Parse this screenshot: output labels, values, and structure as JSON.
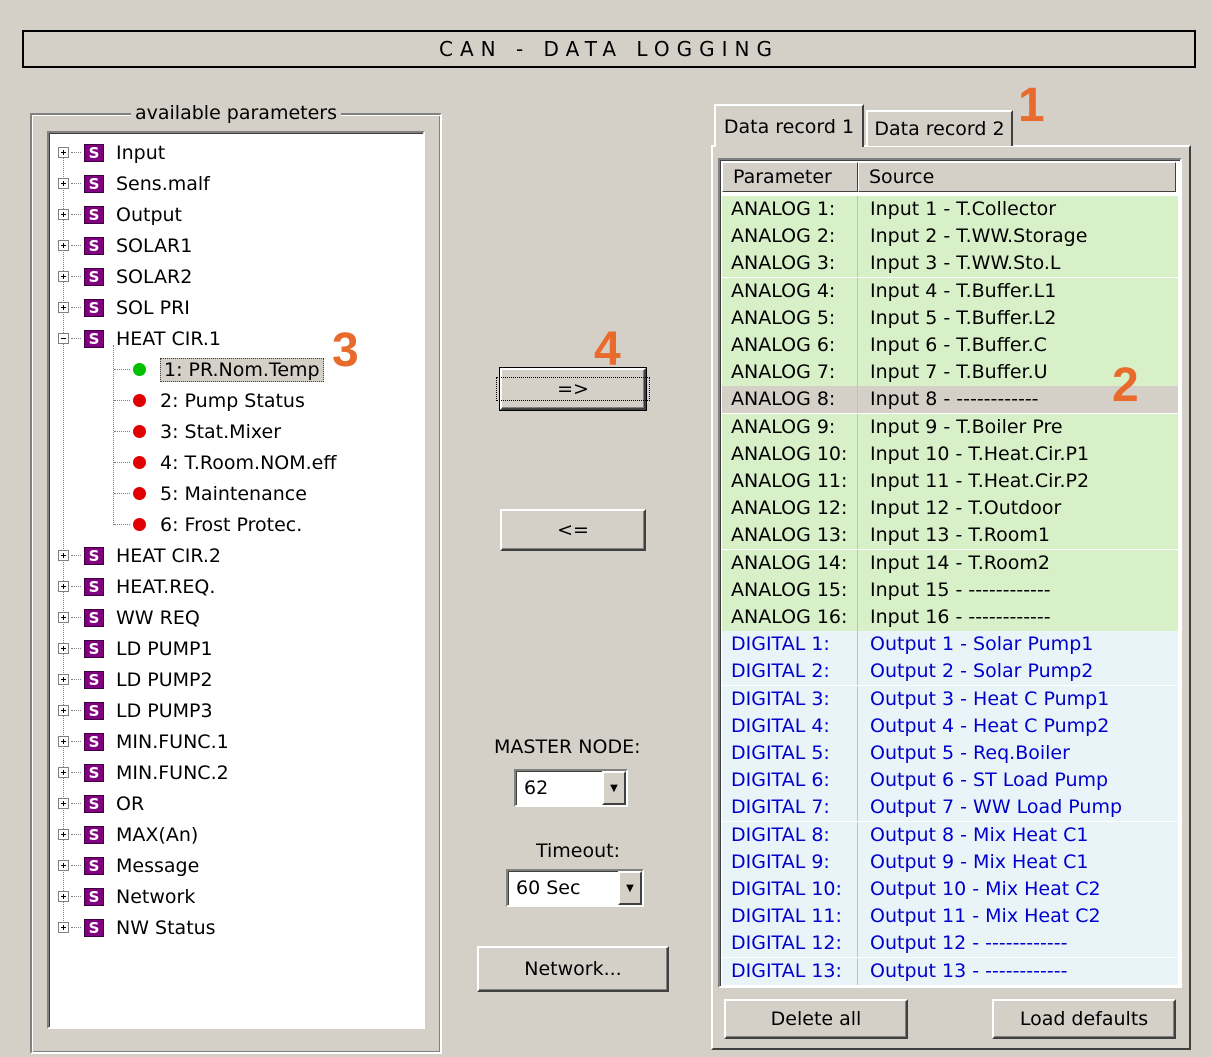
{
  "title": "CAN - DATA LOGGING",
  "available_parameters": {
    "legend": "available parameters",
    "tree": [
      {
        "label": "Input",
        "expanded": false
      },
      {
        "label": "Sens.malf",
        "expanded": false
      },
      {
        "label": "Output",
        "expanded": false
      },
      {
        "label": "SOLAR1",
        "expanded": false
      },
      {
        "label": "SOLAR2",
        "expanded": false
      },
      {
        "label": "SOL PRI",
        "expanded": false
      },
      {
        "label": "HEAT CIR.1",
        "expanded": true
      }
    ],
    "heat_cir1_children": [
      {
        "label": "1: PR.Nom.Temp",
        "status": "green",
        "selected": true
      },
      {
        "label": "2: Pump Status",
        "status": "red"
      },
      {
        "label": "3: Stat.Mixer",
        "status": "red"
      },
      {
        "label": "4: T.Room.NOM.eff",
        "status": "red"
      },
      {
        "label": "5: Maintenance",
        "status": "red"
      },
      {
        "label": "6: Frost Protec.",
        "status": "red"
      }
    ],
    "tree_after": [
      {
        "label": "HEAT CIR.2"
      },
      {
        "label": "HEAT.REQ."
      },
      {
        "label": "WW REQ"
      },
      {
        "label": "LD PUMP1"
      },
      {
        "label": "LD PUMP2"
      },
      {
        "label": "LD PUMP3"
      },
      {
        "label": "MIN.FUNC.1"
      },
      {
        "label": "MIN.FUNC.2"
      },
      {
        "label": "OR"
      },
      {
        "label": "MAX(An)"
      },
      {
        "label": "Message"
      },
      {
        "label": "Network"
      },
      {
        "label": "NW Status"
      }
    ],
    "icon_letter": "S"
  },
  "controls": {
    "add_button": "=>",
    "remove_button": "<=",
    "master_node_label": "MASTER NODE:",
    "master_node_value": "62",
    "timeout_label": "Timeout:",
    "timeout_value": "60 Sec",
    "network_button": "Network..."
  },
  "tabs": [
    {
      "label": "Data record 1",
      "active": true
    },
    {
      "label": "Data record 2",
      "active": false
    }
  ],
  "list": {
    "headers": [
      "Parameter",
      "Source"
    ],
    "rows": [
      {
        "param": "ANALOG 1:",
        "source": "Input 1 - T.Collector",
        "kind": "analog"
      },
      {
        "param": "ANALOG 2:",
        "source": "Input 2 - T.WW.Storage",
        "kind": "analog"
      },
      {
        "param": "ANALOG 3:",
        "source": "Input 3 - T.WW.Sto.L",
        "kind": "analog"
      },
      {
        "param": "ANALOG 4:",
        "source": "Input 4 - T.Buffer.L1",
        "kind": "analog"
      },
      {
        "param": "ANALOG 5:",
        "source": "Input 5 - T.Buffer.L2",
        "kind": "analog"
      },
      {
        "param": "ANALOG 6:",
        "source": "Input 6 - T.Buffer.C",
        "kind": "analog"
      },
      {
        "param": "ANALOG 7:",
        "source": "Input 7 - T.Buffer.U",
        "kind": "analog"
      },
      {
        "param": "ANALOG 8:",
        "source": "Input 8 - ------------",
        "kind": "selected"
      },
      {
        "param": "ANALOG 9:",
        "source": "Input 9 - T.Boiler Pre",
        "kind": "analog"
      },
      {
        "param": "ANALOG 10:",
        "source": "Input 10 - T.Heat.Cir.P1",
        "kind": "analog"
      },
      {
        "param": "ANALOG 11:",
        "source": "Input 11 - T.Heat.Cir.P2",
        "kind": "analog"
      },
      {
        "param": "ANALOG 12:",
        "source": "Input 12 - T.Outdoor",
        "kind": "analog"
      },
      {
        "param": "ANALOG 13:",
        "source": "Input 13 - T.Room1",
        "kind": "analog"
      },
      {
        "param": "ANALOG 14:",
        "source": "Input 14 - T.Room2",
        "kind": "analog"
      },
      {
        "param": "ANALOG 15:",
        "source": "Input 15 - ------------",
        "kind": "analog"
      },
      {
        "param": "ANALOG 16:",
        "source": "Input 16 - ------------",
        "kind": "analog"
      },
      {
        "param": "DIGITAL 1:",
        "source": "Output 1 - Solar Pump1",
        "kind": "digital"
      },
      {
        "param": "DIGITAL 2:",
        "source": "Output 2 - Solar Pump2",
        "kind": "digital"
      },
      {
        "param": "DIGITAL 3:",
        "source": "Output 3 - Heat C Pump1",
        "kind": "digital"
      },
      {
        "param": "DIGITAL 4:",
        "source": "Output 4 - Heat C Pump2",
        "kind": "digital"
      },
      {
        "param": "DIGITAL 5:",
        "source": "Output 5 - Req.Boiler",
        "kind": "digital"
      },
      {
        "param": "DIGITAL 6:",
        "source": "Output 6 - ST Load Pump",
        "kind": "digital"
      },
      {
        "param": "DIGITAL 7:",
        "source": "Output 7 - WW Load Pump",
        "kind": "digital"
      },
      {
        "param": "DIGITAL 8:",
        "source": "Output 8 - Mix Heat C1",
        "kind": "digital"
      },
      {
        "param": "DIGITAL 9:",
        "source": "Output 9 - Mix Heat C1",
        "kind": "digital"
      },
      {
        "param": "DIGITAL 10:",
        "source": "Output 10 - Mix Heat C2",
        "kind": "digital"
      },
      {
        "param": "DIGITAL 11:",
        "source": "Output 11 - Mix Heat C2",
        "kind": "digital"
      },
      {
        "param": "DIGITAL 12:",
        "source": "Output 12 - ------------",
        "kind": "digital"
      },
      {
        "param": "DIGITAL 13:",
        "source": "Output 13 - ------------",
        "kind": "digital"
      }
    ]
  },
  "bottom_buttons": {
    "delete_all": "Delete all",
    "load_defaults": "Load defaults"
  },
  "callouts": [
    "1",
    "2",
    "3",
    "4"
  ],
  "colors": {
    "analog_row": "#d8f0c8",
    "digital_row": "#e8f4f8",
    "digital_text": "#0000cc",
    "callout": "#e86a2c",
    "param_icon": "#800080"
  }
}
